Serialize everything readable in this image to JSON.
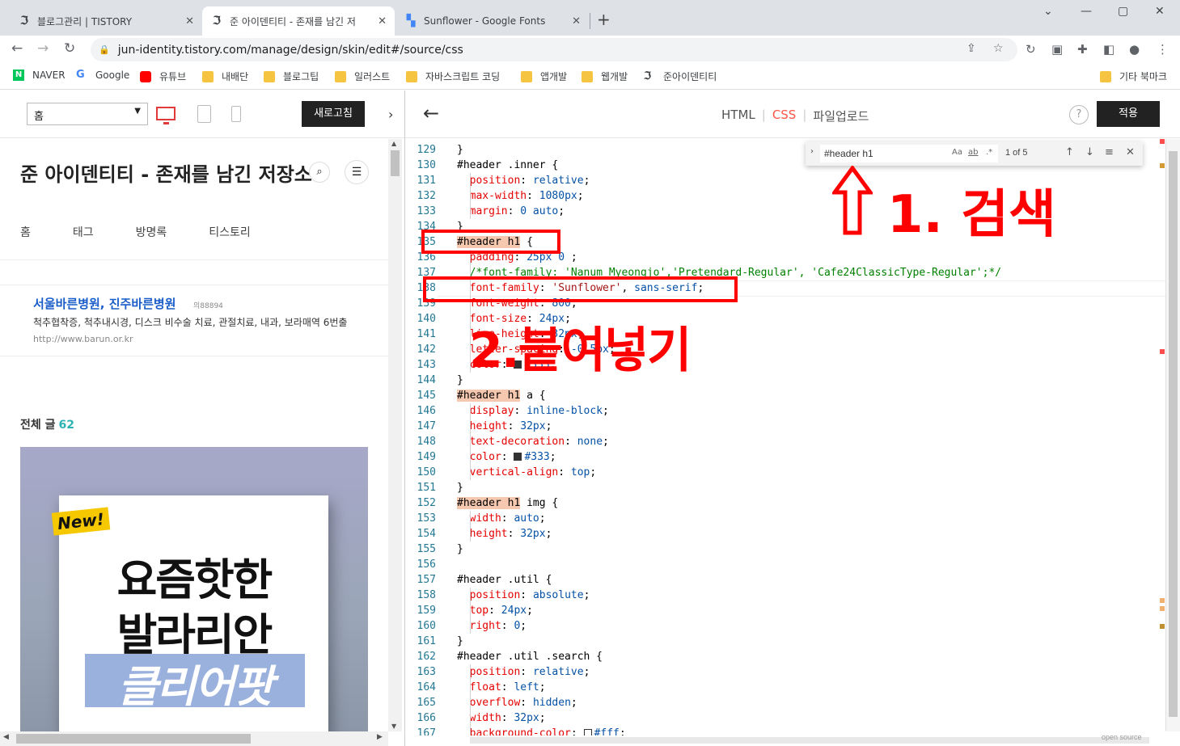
{
  "browser": {
    "tabs": [
      {
        "title": "블로그관리 | TISTORY",
        "icon": "tistory-icon"
      },
      {
        "title": "준 아이덴티티 - 존재를 남긴 저",
        "icon": "tistory-icon"
      },
      {
        "title": "Sunflower - Google Fonts",
        "icon": "google-fonts-icon"
      }
    ],
    "url": "jun-identity.tistory.com/manage/design/skin/edit#/source/css",
    "bookmarks": [
      "NAVER",
      "Google",
      "유튜브",
      "내배단",
      "블로그팁",
      "일러스트",
      "자바스크립트 코딩",
      "앱개발",
      "웹개발",
      "준아이덴티티"
    ],
    "other_bookmarks": "기타 북마크"
  },
  "editor": {
    "page_select": "홈",
    "refresh_label": "새로고침",
    "tabs": [
      "HTML",
      "CSS",
      "파일업로드"
    ],
    "active_tab": "CSS",
    "help": "?",
    "apply_label": "적용"
  },
  "preview": {
    "blog_title": "준 아이덴티티 - 존재를 남긴 저장소",
    "nav": [
      "홈",
      "태그",
      "방명록",
      "티스토리"
    ],
    "ad": {
      "title": "서울바른병원, 진주바른병원",
      "badge": "의88894",
      "desc": "척추협착증, 척추내시경, 디스크 비수술 치료, 관절치료, 내과, 보라매역 6번출",
      "url": "http://www.barun.or.kr"
    },
    "post_count_label": "전체 글",
    "post_count": "62",
    "banner": {
      "tag": "New!",
      "line1": "요즘핫한",
      "line2": "발라리안",
      "line3": "클리어팟"
    }
  },
  "find": {
    "query": "#header h1",
    "options": [
      "Aa",
      "ab",
      ".*"
    ],
    "result": "1 of 5"
  },
  "annotations": {
    "step1": "1. 검색",
    "step2": "2.붙여넣기"
  },
  "footer_badge": "open source",
  "code_lines": [
    {
      "n": "129",
      "html": "}"
    },
    {
      "n": "130",
      "html": "#header .inner {"
    },
    {
      "n": "131",
      "html": "  <span class='k'>position</span>: <span class='v'>relative</span>;"
    },
    {
      "n": "132",
      "html": "  <span class='k'>max-width</span>: <span class='v'>1080px</span>;"
    },
    {
      "n": "133",
      "html": "  <span class='k'>margin</span>: <span class='v'>0 auto</span>;"
    },
    {
      "n": "134",
      "html": "}"
    },
    {
      "n": "135",
      "html": "<span class='hl'>#header h1</span> {"
    },
    {
      "n": "136",
      "html": "  <span class='k'>padding</span>: <span class='v'>25px 0</span> ;"
    },
    {
      "n": "137",
      "html": "  <span class='c'>/*font-family: 'Nanum Myeongjo','Pretendard-Regular', 'Cafe24ClassicType-Regular';*/</span>"
    },
    {
      "n": "138",
      "html": "  <span class='k'>font-family</span>: <span class='s'>'Sunflower'</span>, <span class='v'>sans-serif</span>;"
    },
    {
      "n": "139",
      "html": "  <span class='k'>font-weight</span>: <span class='v'>800</span>;"
    },
    {
      "n": "140",
      "html": "  <span class='k'>font-size</span>: <span class='v'>24px</span>;"
    },
    {
      "n": "141",
      "html": "  <span class='k'>line-height</span>: <span class='v'>32px</span>;"
    },
    {
      "n": "142",
      "html": "  <span class='k'>letter-spacing</span>: <span class='v'>-0.5px</span>;"
    },
    {
      "n": "143",
      "html": "  <span class='k'>color</span>: <span class='sw' style='background:#333'></span><span class='v'>#333</span>;"
    },
    {
      "n": "144",
      "html": "}"
    },
    {
      "n": "145",
      "html": "<span class='hl'>#header h1</span> a {"
    },
    {
      "n": "146",
      "html": "  <span class='k'>display</span>: <span class='v'>inline-block</span>;"
    },
    {
      "n": "147",
      "html": "  <span class='k'>height</span>: <span class='v'>32px</span>;"
    },
    {
      "n": "148",
      "html": "  <span class='k'>text-decoration</span>: <span class='v'>none</span>;"
    },
    {
      "n": "149",
      "html": "  <span class='k'>color</span>: <span class='sw' style='background:#333'></span><span class='v'>#333</span>;"
    },
    {
      "n": "150",
      "html": "  <span class='k'>vertical-align</span>: <span class='v'>top</span>;"
    },
    {
      "n": "151",
      "html": "}"
    },
    {
      "n": "152",
      "html": "<span class='hl'>#header h1</span> img {"
    },
    {
      "n": "153",
      "html": "  <span class='k'>width</span>: <span class='v'>auto</span>;"
    },
    {
      "n": "154",
      "html": "  <span class='k'>height</span>: <span class='v'>32px</span>;"
    },
    {
      "n": "155",
      "html": "}"
    },
    {
      "n": "156",
      "html": ""
    },
    {
      "n": "157",
      "html": "#header .util {"
    },
    {
      "n": "158",
      "html": "  <span class='k'>position</span>: <span class='v'>absolute</span>;"
    },
    {
      "n": "159",
      "html": "  <span class='k'>top</span>: <span class='v'>24px</span>;"
    },
    {
      "n": "160",
      "html": "  <span class='k'>right</span>: <span class='v'>0</span>;"
    },
    {
      "n": "161",
      "html": "}"
    },
    {
      "n": "162",
      "html": "#header .util .search {"
    },
    {
      "n": "163",
      "html": "  <span class='k'>position</span>: <span class='v'>relative</span>;"
    },
    {
      "n": "164",
      "html": "  <span class='k'>float</span>: <span class='v'>left</span>;"
    },
    {
      "n": "165",
      "html": "  <span class='k'>overflow</span>: <span class='v'>hidden</span>;"
    },
    {
      "n": "166",
      "html": "  <span class='k'>width</span>: <span class='v'>32px</span>;"
    },
    {
      "n": "167",
      "html": "  <span class='k'>background-color</span>: <span class='sw' style='background:#fff'></span><span class='v'>#fff</span>;"
    }
  ]
}
